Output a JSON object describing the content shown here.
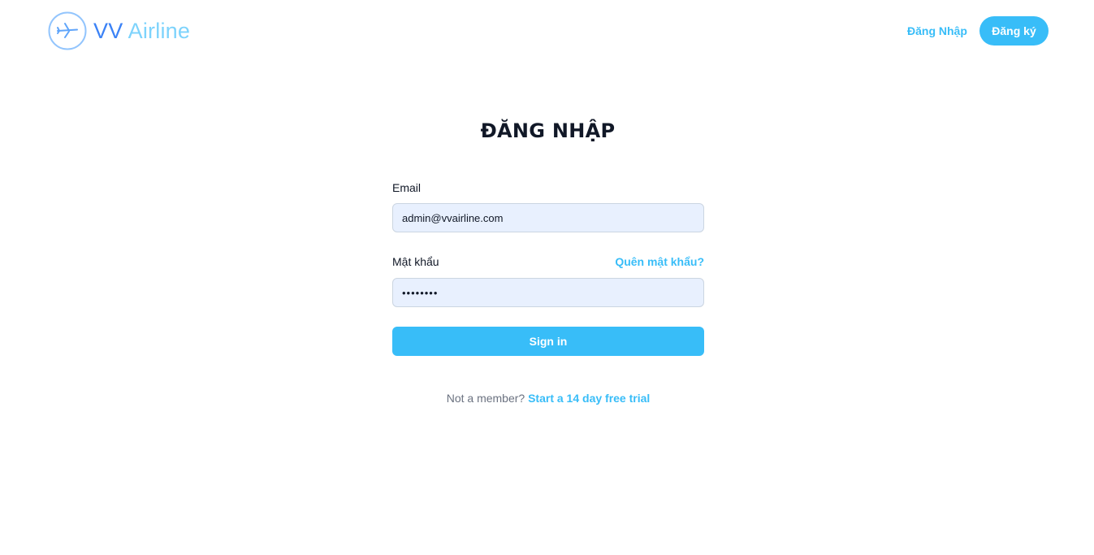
{
  "header": {
    "logo": {
      "icon": "plane-icon",
      "brand_part1": "VV",
      "brand_part2": "Airline"
    },
    "nav": {
      "login_label": "Đăng Nhập",
      "register_label": "Đăng ký"
    }
  },
  "main": {
    "title": "ĐĂNG NHẬP",
    "form": {
      "email_label": "Email",
      "email_value": "admin@vvairline.com",
      "password_label": "Mật khẩu",
      "forgot_label": "Quên mật khẩu?",
      "password_value": "••••••••",
      "submit_label": "Sign in"
    },
    "footer": {
      "prompt": "Not a member?",
      "trial_link": "Start a 14 day free trial"
    }
  },
  "colors": {
    "accent": "#38bdf8",
    "logo_blue": "#3b82f6",
    "logo_light": "#7dd3fc",
    "input_bg": "#e8f0fe"
  }
}
